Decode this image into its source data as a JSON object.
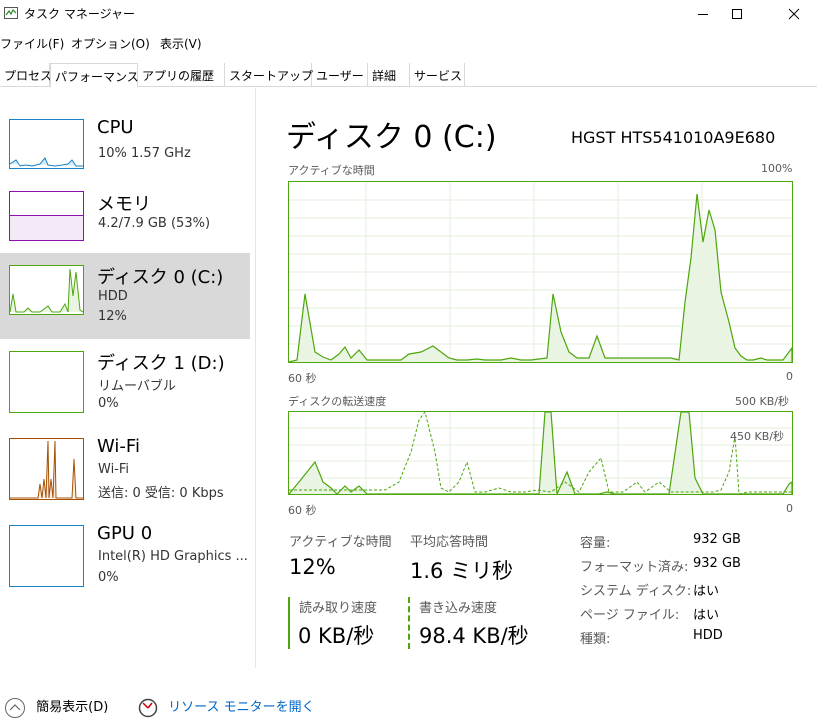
{
  "window": {
    "title": "タスク マネージャー"
  },
  "menu": [
    "ファイル(F)",
    "オプション(O)",
    "表示(V)"
  ],
  "tabs": [
    "プロセス",
    "パフォーマンス",
    "アプリの履歴",
    "スタートアップ",
    "ユーザー",
    "詳細",
    "サービス"
  ],
  "sidebar": [
    {
      "title": "CPU",
      "sub1": "10%  1.57 GHz",
      "sub2": "",
      "sub3": "",
      "color": "#1a83c8"
    },
    {
      "title": "メモリ",
      "sub1": "4.2/7.9 GB (53%)",
      "sub2": "",
      "sub3": "",
      "color": "#8b12ae"
    },
    {
      "title": "ディスク 0 (C:)",
      "sub1": "HDD",
      "sub2": "12%",
      "sub3": "",
      "color": "#4da60c"
    },
    {
      "title": "ディスク 1 (D:)",
      "sub1": "リムーバブル",
      "sub2": "0%",
      "sub3": "",
      "color": "#4da60c"
    },
    {
      "title": "Wi-Fi",
      "sub1": "Wi-Fi",
      "sub2": "送信: 0  受信: 0 Kbps",
      "sub3": "",
      "color": "#a74f01"
    },
    {
      "title": "GPU 0",
      "sub1": "Intel(R) HD Graphics ...",
      "sub2": "0%",
      "sub3": "",
      "color": "#1a83c8"
    }
  ],
  "main": {
    "title": "ディスク 0 (C:)",
    "model": "HGST HTS541010A9E680",
    "graph1": {
      "label": "アクティブな時間",
      "max": "100%",
      "time": "60 秒",
      "zero": "0"
    },
    "graph2": {
      "label": "ディスクの転送速度",
      "max": "500 KB/秒",
      "secondary": "450 KB/秒",
      "time": "60 秒",
      "zero": "0"
    },
    "stats": {
      "active_label": "アクティブな時間",
      "active_value": "12%",
      "response_label": "平均応答時間",
      "response_value": "1.6 ミリ秒",
      "read_label": "読み取り速度",
      "read_value": "0 KB/秒",
      "write_label": "書き込み速度",
      "write_value": "98.4 KB/秒"
    },
    "info": [
      {
        "label": "容量:",
        "value": "932 GB"
      },
      {
        "label": "フォーマット済み:",
        "value": "932 GB"
      },
      {
        "label": "システム ディスク:",
        "value": "はい"
      },
      {
        "label": "ページ ファイル:",
        "value": "はい"
      },
      {
        "label": "種類:",
        "value": "HDD"
      }
    ]
  },
  "bottom": {
    "fewer_details": "簡易表示(D)",
    "resource_monitor": "リソース モニターを開く"
  },
  "colors": {
    "disk": "#4da60c",
    "cpu": "#1a83c8",
    "memory": "#8b12ae",
    "wifi": "#a74f01"
  }
}
